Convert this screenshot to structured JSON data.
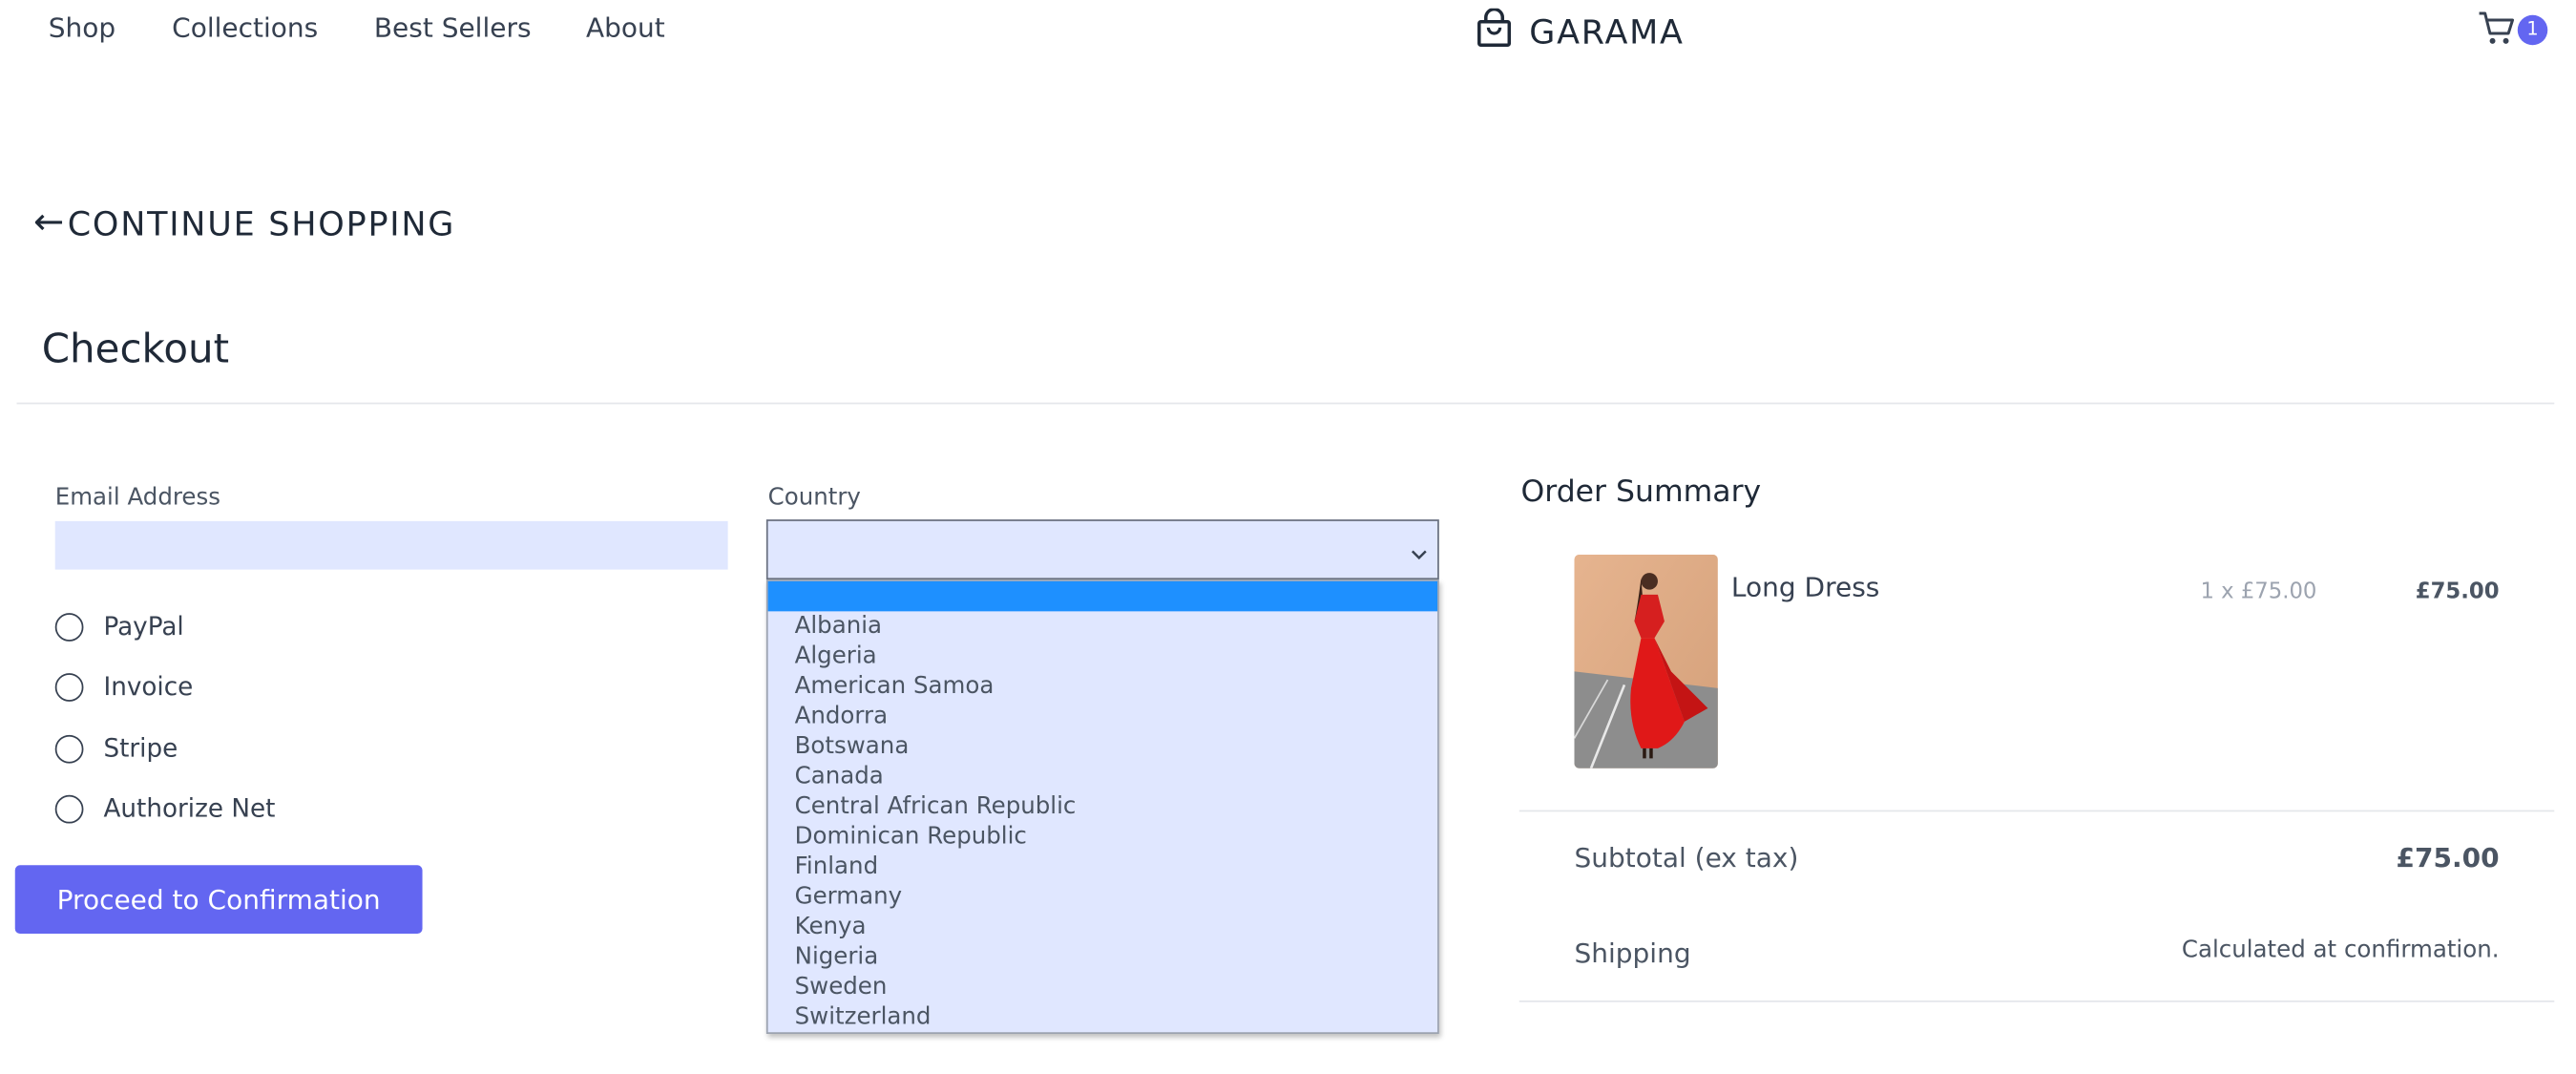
{
  "nav": {
    "links": [
      "Shop",
      "Collections",
      "Best Sellers",
      "About"
    ],
    "brand": "GARAMA",
    "cart_count": "1"
  },
  "continue_shopping": "CONTINUE SHOPPING",
  "checkout": {
    "title": "Checkout",
    "email_label": "Email Address",
    "email_value": "",
    "country_label": "Country",
    "payment_options": [
      "PayPal",
      "Invoice",
      "Stripe",
      "Authorize Net"
    ],
    "proceed_label": "Proceed to Confirmation"
  },
  "country_dropdown": {
    "selected": "",
    "options": [
      "",
      "Albania",
      "Algeria",
      "American Samoa",
      "Andorra",
      "Botswana",
      "Canada",
      "Central African Republic",
      "Dominican Republic",
      "Finland",
      "Germany",
      "Kenya",
      "Nigeria",
      "Sweden",
      "Switzerland"
    ]
  },
  "order_summary": {
    "title": "Order Summary",
    "item": {
      "name": "Long Dress",
      "quantity_price": "1 x £75.00",
      "total": "£75.00"
    },
    "subtotal_label": "Subtotal (ex tax)",
    "subtotal_value": "£75.00",
    "shipping_label": "Shipping",
    "shipping_value": "Calculated at confirmation."
  },
  "colors": {
    "accent": "#6366f1",
    "input_bg": "#e0e7ff",
    "highlight": "#1e90ff"
  }
}
